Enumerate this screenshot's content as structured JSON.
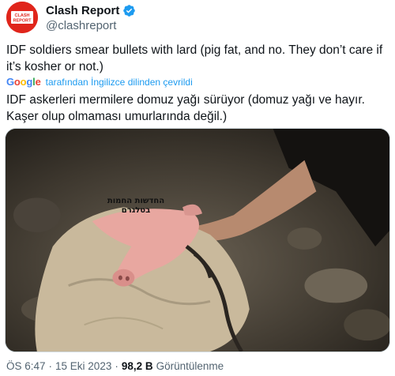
{
  "author": {
    "display_name": "Clash Report",
    "handle": "@clashreport",
    "avatar_text": "CLASH REPORT",
    "verified_icon": "verified-badge-icon"
  },
  "tweet": {
    "text": "IDF soldiers smear bullets with lard (pig fat, and no. They don’t care if it’s kosher or not.)"
  },
  "translation": {
    "provider_logo": "Google",
    "label": "tarafından İngilizce dilinden çevrildi",
    "text": "IDF askerleri mermilere domuz yağı sürüyor (domuz yağı ve hayır. Kaşer olup olmaması umurlarında değil.)"
  },
  "media": {
    "overlay_caption": "החדשות החמות בטלגרם"
  },
  "meta": {
    "time": "ÖS 6:47",
    "date": "15 Eki 2023",
    "separator": "·",
    "view_count": "98,2 B",
    "view_label": "Görüntülenme"
  },
  "colors": {
    "text_primary": "#0f1419",
    "text_secondary": "#536471",
    "link": "#1d9bf0",
    "verified": "#1d9bf0",
    "avatar_bg": "#e0251b"
  }
}
